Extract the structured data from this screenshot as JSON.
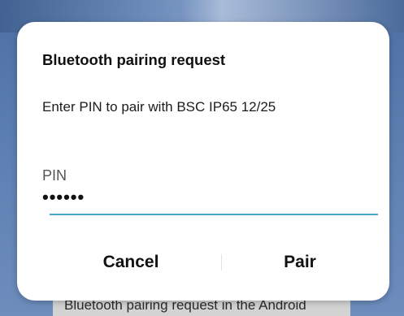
{
  "dialog": {
    "title": "Bluetooth pairing request",
    "message": "Enter PIN to pair with BSC IP65 12/25",
    "pin_label": "PIN",
    "pin_value": "••••••",
    "cancel_label": "Cancel",
    "pair_label": "Pair",
    "accent_color": "#4ba6c9"
  },
  "background": {
    "caption": "Bluetooth pairing request in the Android"
  }
}
